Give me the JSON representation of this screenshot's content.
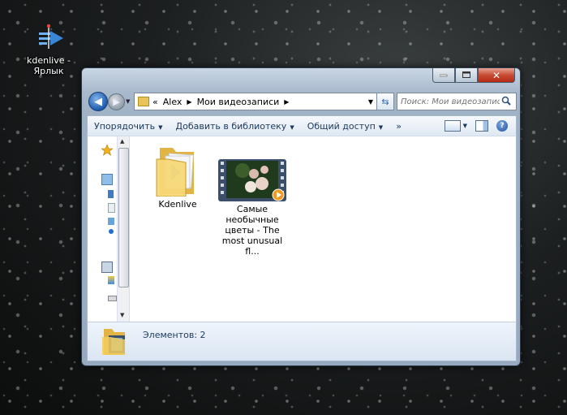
{
  "desktop": {
    "shortcut": {
      "label_line1": "kdenlive -",
      "label_line2": "Ярлык"
    }
  },
  "window": {
    "address": {
      "overflow": "«",
      "crumbs": [
        "Alex",
        "Мои видеозаписи"
      ]
    },
    "search": {
      "placeholder": "Поиск: Мои видеозаписи"
    },
    "toolbar": {
      "organize": "Упорядочить",
      "add_to_library": "Добавить в библиотеку",
      "share": "Общий доступ",
      "more": "»"
    },
    "files": [
      {
        "name": "Kdenlive",
        "type": "folder"
      },
      {
        "name_lines": [
          "Самые",
          "необычные",
          "цветы - The",
          "most unusual fl..."
        ],
        "type": "video"
      }
    ],
    "details": {
      "item_count": "Элементов: 2"
    }
  }
}
